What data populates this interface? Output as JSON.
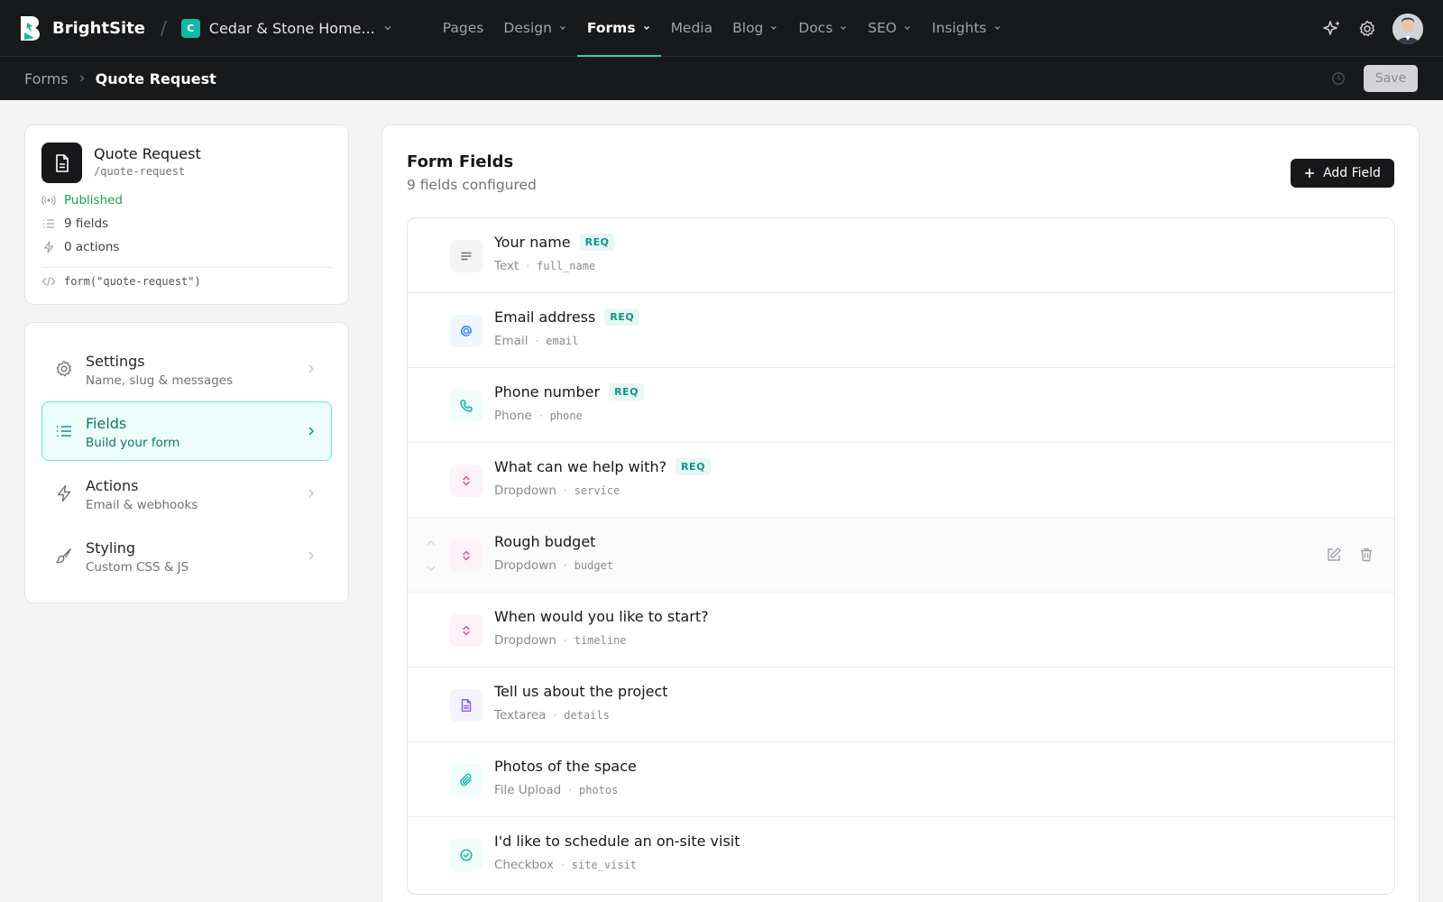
{
  "app": {
    "name": "BrightSite"
  },
  "site": {
    "badge": "C",
    "name": "Cedar & Stone Home..."
  },
  "nav": [
    {
      "label": "Pages",
      "dropdown": false,
      "active": false
    },
    {
      "label": "Design",
      "dropdown": true,
      "active": false
    },
    {
      "label": "Forms",
      "dropdown": true,
      "active": true
    },
    {
      "label": "Media",
      "dropdown": false,
      "active": false
    },
    {
      "label": "Blog",
      "dropdown": true,
      "active": false
    },
    {
      "label": "Docs",
      "dropdown": true,
      "active": false
    },
    {
      "label": "SEO",
      "dropdown": true,
      "active": false
    },
    {
      "label": "Insights",
      "dropdown": true,
      "active": false
    }
  ],
  "breadcrumb": {
    "root": "Forms",
    "current": "Quote Request"
  },
  "toolbar": {
    "save_label": "Save"
  },
  "form": {
    "title": "Quote Request",
    "slug": "/quote-request",
    "status": "Published",
    "fields_count": "9 fields",
    "actions_count": "0 actions",
    "embed_code": "form(\"quote-request\")"
  },
  "menu": [
    {
      "title": "Settings",
      "sub": "Name, slug & messages",
      "icon": "gear-icon",
      "active": false
    },
    {
      "title": "Fields",
      "sub": "Build your form",
      "icon": "list-icon",
      "active": true
    },
    {
      "title": "Actions",
      "sub": "Email & webhooks",
      "icon": "bolt-icon",
      "active": false
    },
    {
      "title": "Styling",
      "sub": "Custom CSS & JS",
      "icon": "brush-icon",
      "active": false
    }
  ],
  "main": {
    "title": "Form Fields",
    "subtitle": "9 fields configured",
    "add_label": "Add Field",
    "req_label": "REQ"
  },
  "fields": [
    {
      "label": "Your name",
      "type": "Text",
      "key": "full_name",
      "required": true,
      "icon": "text-icon",
      "icon_color": "#71717a",
      "icon_bg": "#f4f4f5"
    },
    {
      "label": "Email address",
      "type": "Email",
      "key": "email",
      "required": true,
      "icon": "at-sign-icon",
      "icon_color": "#3b82f6",
      "icon_bg": "#eff6ff"
    },
    {
      "label": "Phone number",
      "type": "Phone",
      "key": "phone",
      "required": true,
      "icon": "phone-icon",
      "icon_color": "#14b8a6",
      "icon_bg": "#f0fdfa"
    },
    {
      "label": "What can we help with?",
      "type": "Dropdown",
      "key": "service",
      "required": true,
      "icon": "dropdown-icon",
      "icon_color": "#ec4899",
      "icon_bg": "#fdf2f8"
    },
    {
      "label": "Rough budget",
      "type": "Dropdown",
      "key": "budget",
      "required": false,
      "icon": "dropdown-icon",
      "icon_color": "#ec4899",
      "icon_bg": "#fdf2f8",
      "hovered": true
    },
    {
      "label": "When would you like to start?",
      "type": "Dropdown",
      "key": "timeline",
      "required": false,
      "icon": "dropdown-icon",
      "icon_color": "#ec4899",
      "icon_bg": "#fdf2f8"
    },
    {
      "label": "Tell us about the project",
      "type": "Textarea",
      "key": "details",
      "required": false,
      "icon": "document-icon",
      "icon_color": "#8b5cf6",
      "icon_bg": "#f5f3ff"
    },
    {
      "label": "Photos of the space",
      "type": "File Upload",
      "key": "photos",
      "required": false,
      "icon": "paperclip-icon",
      "icon_color": "#14b8a6",
      "icon_bg": "#f0fdfa"
    },
    {
      "label": "I'd like to schedule an on-site visit",
      "type": "Checkbox",
      "key": "site_visit",
      "required": false,
      "icon": "check-circle-icon",
      "icon_color": "#14b8a6",
      "icon_bg": "#f0fdfa"
    }
  ],
  "colors": {
    "accent": "#14b8a6",
    "topbar": "#18191b",
    "published": "#16a34a"
  }
}
